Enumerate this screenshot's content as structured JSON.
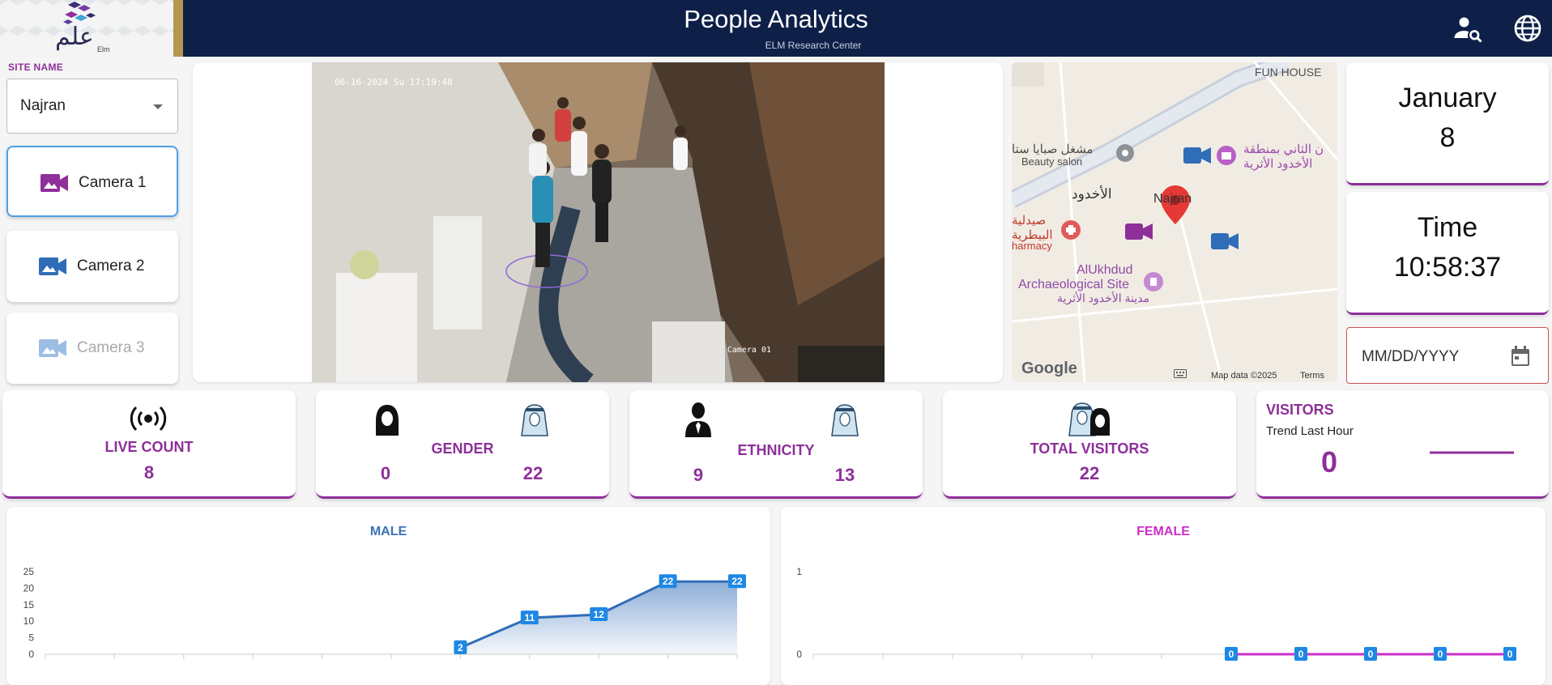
{
  "header": {
    "title": "People Analytics",
    "subtitle": "ELM Research Center",
    "logo_arabic": "علم",
    "logo_latin": "Elm"
  },
  "site": {
    "label": "SITE NAME",
    "selected": "Najran"
  },
  "cameras": [
    {
      "label": "Camera 1",
      "state": "active",
      "color": "#8e2f9a"
    },
    {
      "label": "Camera 2",
      "state": "normal",
      "color": "#2f6db8"
    },
    {
      "label": "Camera 3",
      "state": "disabled",
      "color": "#9dbde4"
    }
  ],
  "video": {
    "timestamp": "06-16-2024 Su 17:19:48",
    "camera_label": "Camera 01"
  },
  "map": {
    "labels": {
      "fun_house": "FUN HOUSE",
      "beauty_ar": "مشغل صبايا ستا",
      "beauty": "Beauty salon",
      "poi_ar1": "ن الثاني بمنطقة",
      "poi_ar2": "الأخدود الأثرية",
      "area_ar": "الأخدود",
      "najran": "Najran",
      "pharmacy_ar1": "صيدلية",
      "pharmacy_ar2": "البيطرية",
      "pharmacy": "harmacy",
      "site1": "AlUkhdud",
      "site2": "Archaeological Site",
      "site_ar": "مدينة الأخدود الأثرية"
    },
    "google": "Google",
    "map_data": "Map data ©2025",
    "terms": "Terms"
  },
  "date_card": {
    "month": "January",
    "day": "8"
  },
  "time_card": {
    "label": "Time",
    "value": "10:58:37"
  },
  "date_input": {
    "placeholder": "MM/DD/YYYY"
  },
  "stats": {
    "live_count": {
      "label": "LIVE COUNT",
      "value": "8"
    },
    "gender": {
      "label": "GENDER",
      "female": "0",
      "male": "22"
    },
    "ethnicity": {
      "label": "ETHNICITY",
      "a": "9",
      "b": "13"
    },
    "total": {
      "label": "TOTAL VISITORS",
      "value": "22"
    },
    "visitors": {
      "label": "VISITORS",
      "sub": "Trend Last Hour",
      "value": "0"
    }
  },
  "chart_data": [
    {
      "type": "area",
      "title": "MALE",
      "color": "#2f6db8",
      "yticks": [
        0,
        5,
        10,
        15,
        20,
        25
      ],
      "ylim": [
        0,
        25
      ],
      "n_slots": 11,
      "points": [
        {
          "slot": 6,
          "value": 2
        },
        {
          "slot": 7,
          "value": 11
        },
        {
          "slot": 8,
          "value": 12
        },
        {
          "slot": 9,
          "value": 22
        },
        {
          "slot": 10,
          "value": 22
        }
      ]
    },
    {
      "type": "line",
      "title": "FEMALE",
      "color": "#cc2fc8",
      "yticks": [
        0,
        1
      ],
      "ylim": [
        0,
        1
      ],
      "n_slots": 11,
      "points": [
        {
          "slot": 6,
          "value": 0
        },
        {
          "slot": 7,
          "value": 0
        },
        {
          "slot": 8,
          "value": 0
        },
        {
          "slot": 9,
          "value": 0
        },
        {
          "slot": 10,
          "value": 0
        }
      ]
    }
  ]
}
